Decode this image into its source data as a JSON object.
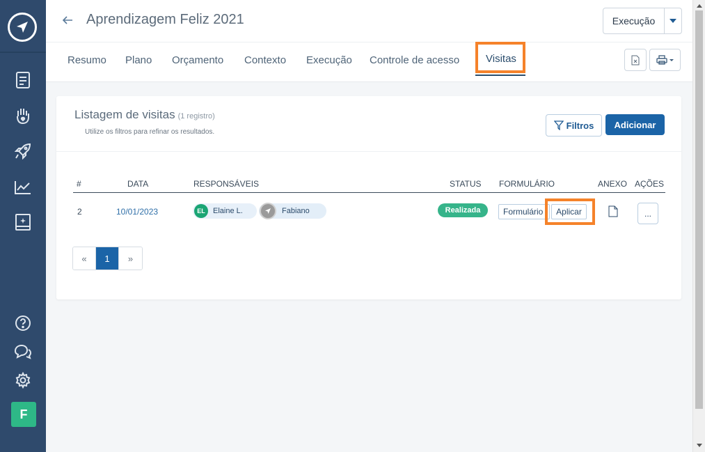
{
  "window": {
    "border_color": "#888888"
  },
  "sidebar": {
    "logo_icon": "paper-plane-logo-icon",
    "nav_icons": [
      "document-icon",
      "hand-heart-icon",
      "rocket-icon",
      "chart-line-icon",
      "notebook-sparkle-icon"
    ],
    "bottom_icons": [
      "help-icon",
      "chat-icon",
      "gear-icon"
    ],
    "avatar_letter": "F",
    "avatar_color": "#2eb887",
    "bg_color": "#2f4a6c"
  },
  "header": {
    "title": "Aprendizagem Feliz 2021",
    "exec_button": "Execução"
  },
  "tabs": [
    "Resumo",
    "Plano",
    "Orçamento",
    "Contexto",
    "Execução",
    "Controle de acesso",
    "Visitas"
  ],
  "active_tab": "Visitas",
  "card": {
    "title": "Listagem de visitas",
    "count": "(1 registro)",
    "subtitle": "Utilize os filtros para refinar os resultados.",
    "filter_button": "Filtros",
    "add_button": "Adicionar"
  },
  "table": {
    "columns": [
      "#",
      "DATA",
      "RESPONSÁVEIS",
      "STATUS",
      "FORMULÁRIO",
      "ANEXO",
      "AÇÕES"
    ],
    "rows": [
      {
        "num": "2",
        "date": "10/01/2023",
        "people": [
          {
            "initials": "EL",
            "name": "Elaine L.",
            "color": "#1aa574"
          },
          {
            "initials": "",
            "name": "Fabiano",
            "color": "#9a9a9a"
          }
        ],
        "status": "Realizada",
        "form_button": "Formulário",
        "apply_button": "Aplicar",
        "actions": "..."
      }
    ]
  },
  "pagination": {
    "prev": "«",
    "current": "1",
    "next": "»"
  },
  "accent_colors": {
    "primary": "#1b64a7",
    "highlight": "#f5822a",
    "success": "#36b48a"
  }
}
